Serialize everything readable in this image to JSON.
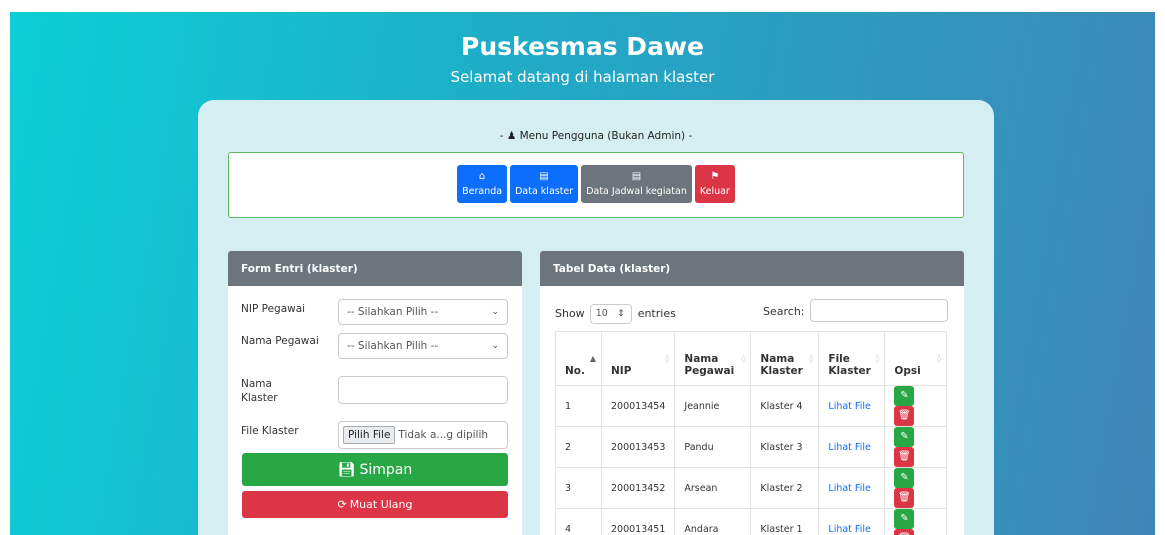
{
  "header": {
    "title": "Puskesmas Dawe",
    "subtitle": "Selamat datang di halaman klaster"
  },
  "menu": {
    "title": "- ♟ Menu Pengguna (Bukan Admin) -",
    "buttons": [
      {
        "label": "Beranda",
        "icon": "home-icon",
        "color": "#0d6efd"
      },
      {
        "label": "Data klaster",
        "icon": "table-icon",
        "color": "#0d6efd"
      },
      {
        "label": "Data Jadwal kegiatan",
        "icon": "table-icon",
        "color": "#6c757d"
      },
      {
        "label": "Keluar",
        "icon": "bookmark-icon",
        "color": "#dc3545"
      }
    ]
  },
  "form": {
    "title": "Form Entri (klaster)",
    "nip_label": "NIP Pegawai",
    "nip_value": "-- Silahkan Pilih --",
    "nama_pegawai_label": "Nama Pegawai",
    "nama_pegawai_value": "-- Silahkan Pilih --",
    "nama_klaster_label": "Nama Klaster",
    "nama_klaster_value": "",
    "file_label": "File Klaster",
    "file_button": "Pilih File",
    "file_status": "Tidak a...g dipilih",
    "save_label": "Simpan",
    "reload_label": "Muat Ulang"
  },
  "table": {
    "title": "Tabel Data (klaster)",
    "show_label": "Show",
    "entries_value": "10",
    "entries_label": "entries",
    "search_label": "Search:",
    "search_value": "",
    "columns": [
      "No.",
      "NIP",
      "Nama Pegawai",
      "Nama Klaster",
      "File Klaster",
      "Opsi"
    ],
    "rows": [
      {
        "no": "1",
        "nip": "200013454",
        "nama": "Jeannie",
        "klaster": "Klaster 4",
        "file": "Lihat File"
      },
      {
        "no": "2",
        "nip": "200013453",
        "nama": "Pandu",
        "klaster": "Klaster 3",
        "file": "Lihat File"
      },
      {
        "no": "3",
        "nip": "200013452",
        "nama": "Arsean",
        "klaster": "Klaster 2",
        "file": "Lihat File"
      },
      {
        "no": "4",
        "nip": "200013451",
        "nama": "Andara",
        "klaster": "Klaster 1",
        "file": "Lihat File"
      }
    ]
  },
  "colors": {
    "primary": "#0d6efd",
    "success": "#28a745",
    "danger": "#dc3545",
    "secondary": "#6c757d"
  }
}
